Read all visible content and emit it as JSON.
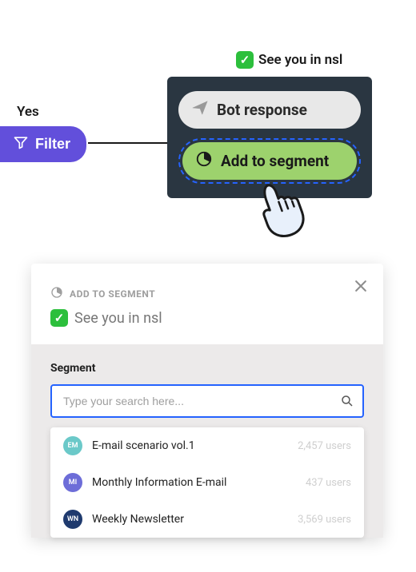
{
  "top": {
    "yes_label": "Yes",
    "filter_label": "Filter",
    "title_label": "See you in nsl"
  },
  "node": {
    "bot_response_label": "Bot response",
    "add_to_segment_label": "Add to segment"
  },
  "panel": {
    "subtitle": "ADD TO SEGMENT",
    "title": "See you in nsl",
    "segment_heading": "Segment",
    "search_placeholder": "Type your search here...",
    "items": [
      {
        "avatar_text": "EM",
        "avatar_color": "#6bc9c9",
        "label": "E-mail scenario vol.1",
        "count": "2,457 users"
      },
      {
        "avatar_text": "MI",
        "avatar_color": "#6d6dd8",
        "label": "Monthly Information E-mail",
        "count": "437 users"
      },
      {
        "avatar_text": "WN",
        "avatar_color": "#1f3a6e",
        "label": "Weekly Newsletter",
        "count": "3,569 users"
      }
    ]
  }
}
